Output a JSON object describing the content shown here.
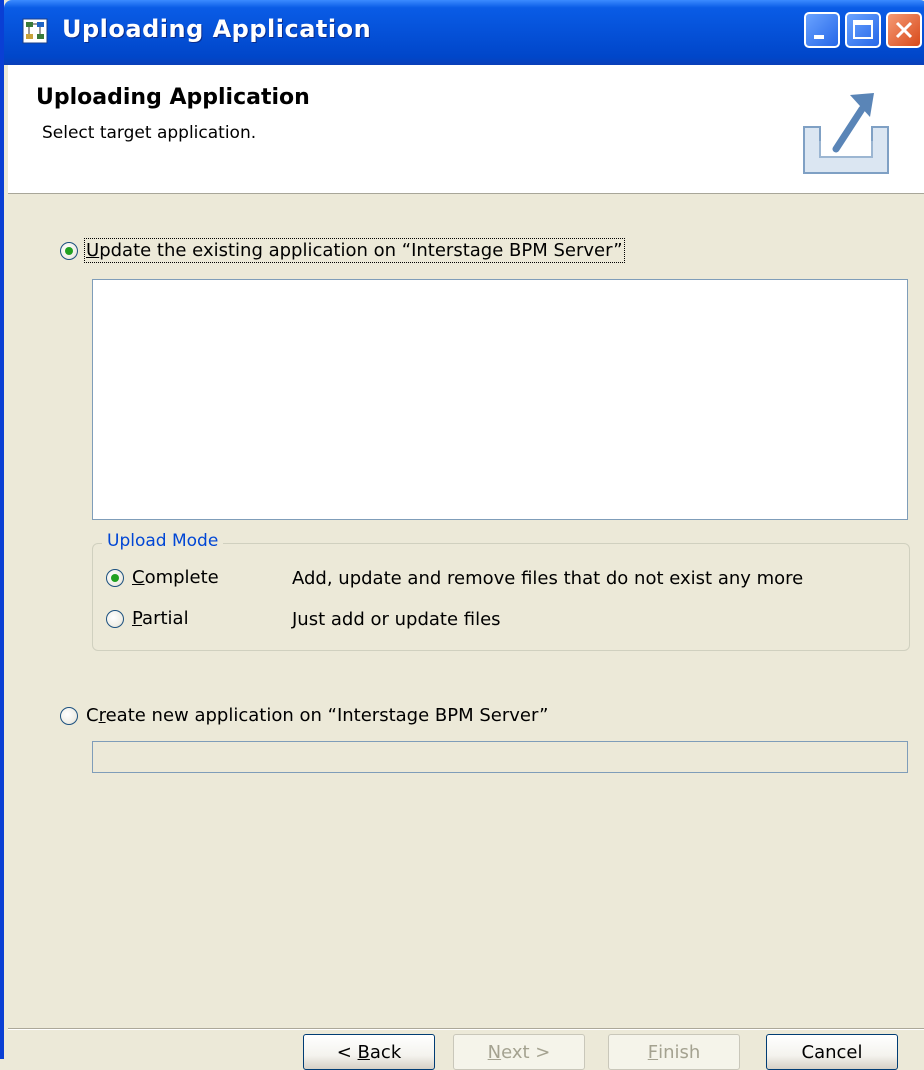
{
  "window": {
    "title": "Uploading Application"
  },
  "banner": {
    "title": "Uploading Application",
    "subtitle": "Select target application.",
    "icon": "upload-arrow-icon"
  },
  "update_option": {
    "label_prefix": "",
    "mnemonic": "U",
    "label_rest": "pdate the existing application on “Interstage BPM Server”",
    "selected": true
  },
  "existing_applications": [],
  "upload_mode": {
    "legend": "Upload Mode",
    "options": [
      {
        "mnemonic": "C",
        "label_rest": "omplete",
        "description": "Add, update and remove files that do not exist any more",
        "selected": true
      },
      {
        "mnemonic": "P",
        "label_rest": "artial",
        "description": "Just add or update files",
        "selected": false
      }
    ]
  },
  "create_option": {
    "label_prefix": "C",
    "mnemonic": "r",
    "label_rest": "eate new application on “Interstage BPM Server”",
    "selected": false,
    "input_value": ""
  },
  "buttons": {
    "back": {
      "prefix": "< ",
      "mnemonic": "B",
      "rest": "ack",
      "enabled": true
    },
    "next": {
      "prefix": "",
      "mnemonic": "N",
      "rest": "ext >",
      "enabled": false
    },
    "finish": {
      "prefix": "",
      "mnemonic": "F",
      "rest": "inish",
      "enabled": false
    },
    "cancel": {
      "label": "Cancel",
      "enabled": true
    }
  },
  "colors": {
    "titlebar": "#0551d8",
    "dialog_bg": "#ece9d8",
    "groupbox_legend": "#0046d5",
    "radio_dot": "#21a121"
  }
}
